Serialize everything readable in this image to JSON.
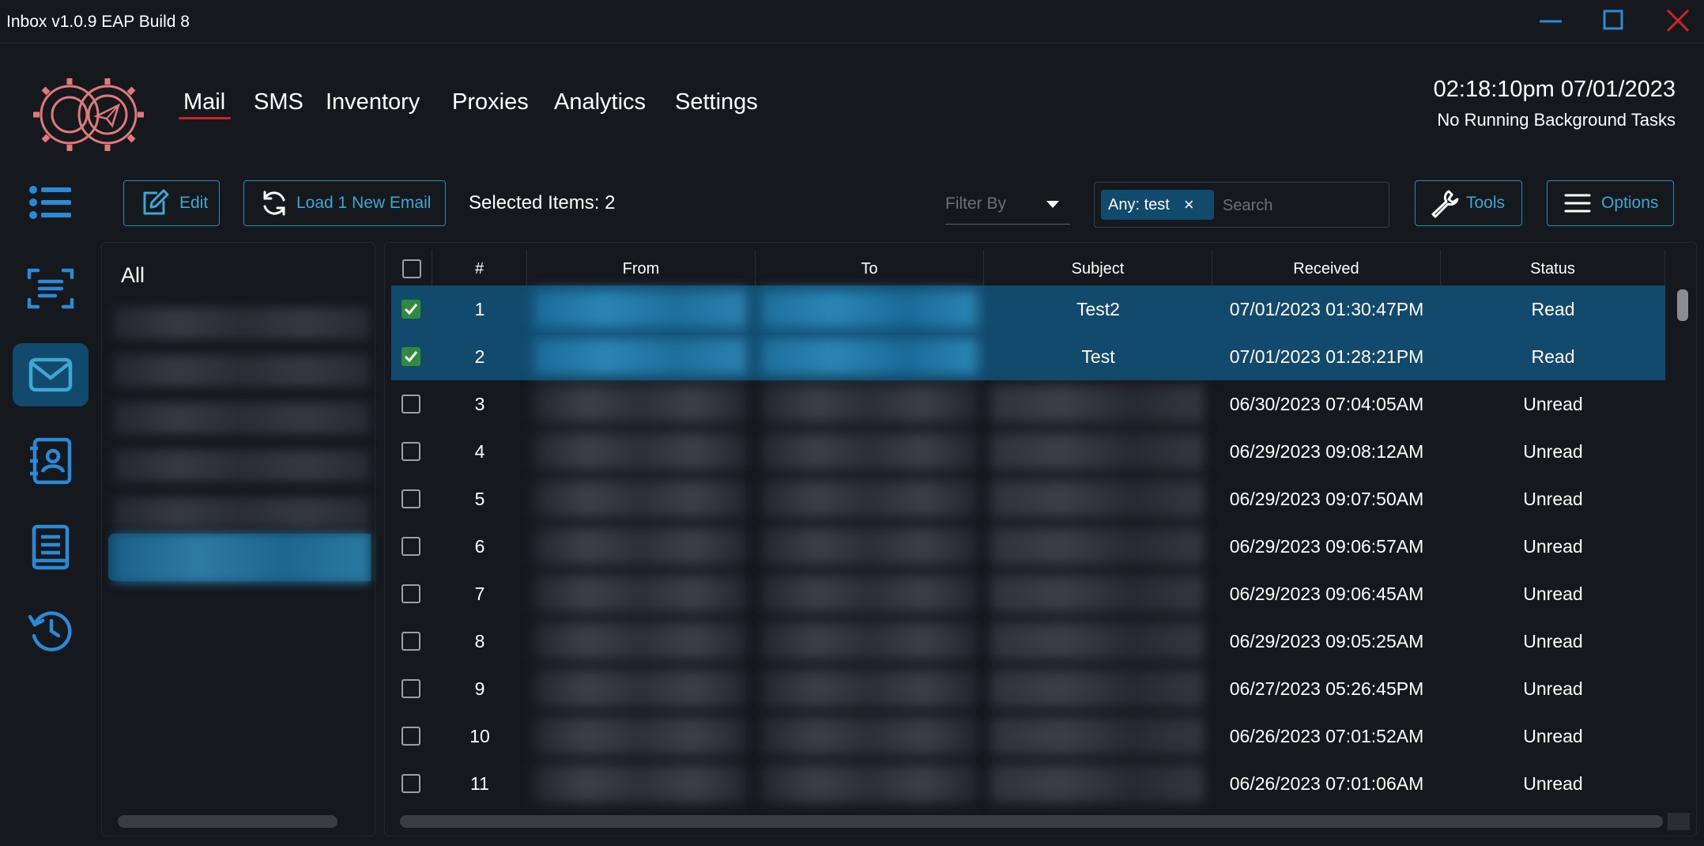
{
  "window": {
    "title": "Inbox v1.0.9 EAP Build 8",
    "controls": {
      "minimize": "minimize-icon",
      "maximize": "maximize-icon",
      "close": "close-icon"
    }
  },
  "nav": {
    "tabs": [
      {
        "label": "Mail",
        "active": true
      },
      {
        "label": "SMS"
      },
      {
        "label": "Inventory"
      },
      {
        "label": "Proxies"
      },
      {
        "label": "Analytics"
      },
      {
        "label": "Settings"
      }
    ],
    "accent": "#d1212a"
  },
  "status": {
    "clock": "02:18:10pm 07/01/2023",
    "tasks": "No Running Background Tasks"
  },
  "sidebar": {
    "items": [
      {
        "icon": "list-icon"
      },
      {
        "icon": "scan-text-icon"
      },
      {
        "icon": "mail-icon",
        "active": true
      },
      {
        "icon": "contacts-book-icon"
      },
      {
        "icon": "document-icon"
      },
      {
        "icon": "history-icon"
      }
    ]
  },
  "toolbar": {
    "edit_label": "Edit",
    "load_label": "Load 1 New Email",
    "selected_label": "Selected Items: 2",
    "filter_placeholder": "Filter By",
    "chip_label": "Any: test",
    "chip_close": "×",
    "search_placeholder": "Search",
    "tools_label": "Tools",
    "options_label": "Options"
  },
  "folders": {
    "all_label": "All"
  },
  "table": {
    "columns": [
      "#",
      "From",
      "To",
      "Subject",
      "Received",
      "Status"
    ],
    "rows": [
      {
        "num": "1",
        "subject": "Test2",
        "received": "07/01/2023 01:30:47PM",
        "status": "Read",
        "selected": true
      },
      {
        "num": "2",
        "subject": "Test",
        "received": "07/01/2023 01:28:21PM",
        "status": "Read",
        "selected": true
      },
      {
        "num": "3",
        "subject": "",
        "received": "06/30/2023 07:04:05AM",
        "status": "Unread",
        "selected": false
      },
      {
        "num": "4",
        "subject": "",
        "received": "06/29/2023 09:08:12AM",
        "status": "Unread",
        "selected": false
      },
      {
        "num": "5",
        "subject": "",
        "received": "06/29/2023 09:07:50AM",
        "status": "Unread",
        "selected": false
      },
      {
        "num": "6",
        "subject": "",
        "received": "06/29/2023 09:06:57AM",
        "status": "Unread",
        "selected": false
      },
      {
        "num": "7",
        "subject": "",
        "received": "06/29/2023 09:06:45AM",
        "status": "Unread",
        "selected": false
      },
      {
        "num": "8",
        "subject": "",
        "received": "06/29/2023 09:05:25AM",
        "status": "Unread",
        "selected": false
      },
      {
        "num": "9",
        "subject": "",
        "received": "06/27/2023 05:26:45PM",
        "status": "Unread",
        "selected": false
      },
      {
        "num": "10",
        "subject": "",
        "received": "06/26/2023 07:01:52AM",
        "status": "Unread",
        "selected": false
      },
      {
        "num": "11",
        "subject": "",
        "received": "06/26/2023 07:01:06AM",
        "status": "Unread",
        "selected": false
      }
    ]
  },
  "colors": {
    "accent": "#3ea7d2",
    "selection": "#124a6d",
    "check": "#2e8b3f"
  }
}
